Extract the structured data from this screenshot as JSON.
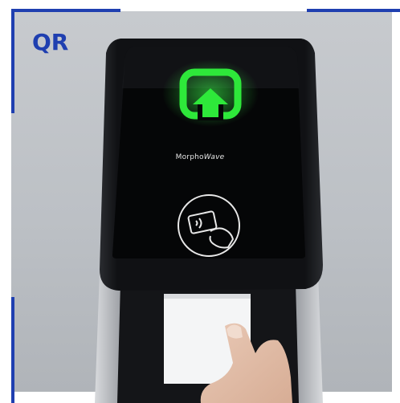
{
  "badge": {
    "text": "QR"
  },
  "device": {
    "brand_prefix": "Morpho",
    "brand_suffix": "Wave",
    "status_icon": "green-upload-arrow-icon",
    "contactless_icon": "card-tap-icon"
  },
  "colors": {
    "accent_blue": "#1f3fb0",
    "indicator_green": "#2ee83a",
    "device_black": "#0c0d0f"
  }
}
